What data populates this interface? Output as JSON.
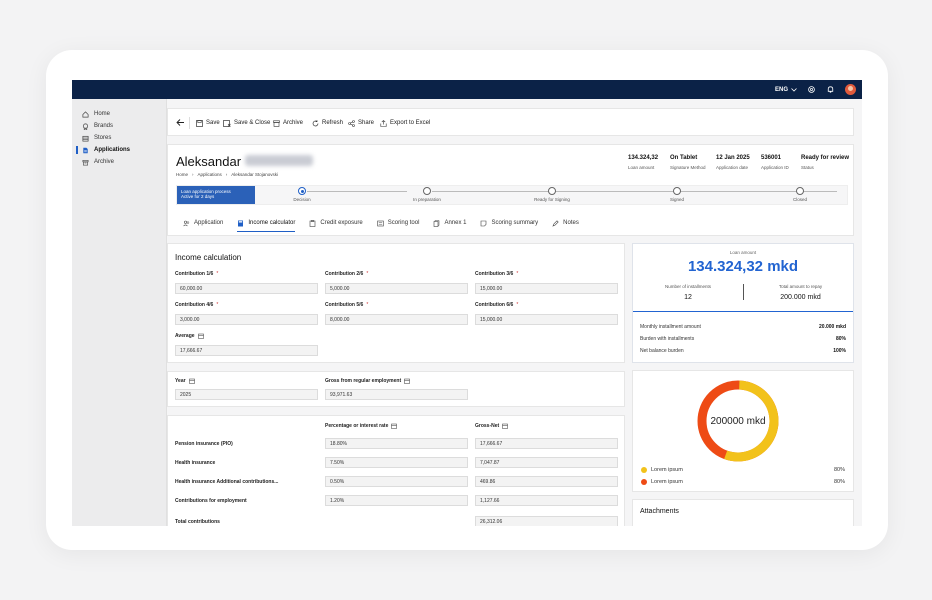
{
  "topbar": {
    "language": "ENG"
  },
  "sidebar": {
    "items": [
      {
        "label": "Home",
        "icon": "home-icon"
      },
      {
        "label": "Brands",
        "icon": "brand-icon"
      },
      {
        "label": "Stores",
        "icon": "store-icon"
      },
      {
        "label": "Applications",
        "icon": "document-icon",
        "active": true
      },
      {
        "label": "Archive",
        "icon": "archive-icon"
      }
    ]
  },
  "toolbar": {
    "save": "Save",
    "save_close": "Save & Close",
    "archive": "Archive",
    "refresh": "Refresh",
    "share": "Share",
    "export": "Export to Excel"
  },
  "header": {
    "name": "Aleksandar",
    "breadcrumb": [
      "Home",
      "Applications",
      "Aleksandar Stojanovski"
    ],
    "summary": [
      {
        "value": "134.324,32",
        "label": "Loan amount"
      },
      {
        "value": "On Tablet",
        "label": "Signature Method"
      },
      {
        "value": "12 Jan 2025",
        "label": "Application date"
      },
      {
        "value": "536001",
        "label": "Application ID"
      },
      {
        "value": "Ready for review",
        "label": "Status"
      }
    ],
    "process": {
      "title": "Loan application process",
      "subtitle": "Active for 2 days"
    },
    "steps": [
      "Decision",
      "In preparation",
      "Ready for Signing",
      "Signed",
      "Closed"
    ]
  },
  "tabs": [
    "Application",
    "Income calculator",
    "Credit exposure",
    "Scoring tool",
    "Annex 1",
    "Scoring summary",
    "Notes"
  ],
  "income": {
    "title": "Income calculation",
    "fields": [
      {
        "label": "Contribution 1/6",
        "value": "60,000.00"
      },
      {
        "label": "Contribution 2/6",
        "value": "5,000.00"
      },
      {
        "label": "Contribution 3/6",
        "value": "15,000.00"
      },
      {
        "label": "Contribution 4/6",
        "value": "3,000.00"
      },
      {
        "label": "Contribution 5/6",
        "value": "8,000.00"
      },
      {
        "label": "Contribution 6/6",
        "value": "15,000.00"
      }
    ],
    "average_label": "Average",
    "average_value": "17,666.67"
  },
  "year_panel": {
    "year_label": "Year",
    "year_value": "2025",
    "gross_label": "Gross from regular employment",
    "gross_value": "93,971.63"
  },
  "contrib_table": {
    "col1": "Percentage or interest rate",
    "col2": "Gross-Net",
    "rows": [
      {
        "label": "Pension insurance (PIO)",
        "rate": "18.80%",
        "amount": "17,666.67"
      },
      {
        "label": "Health insurance",
        "rate": "7.50%",
        "amount": "7,047.87"
      },
      {
        "label": "Health insurance Additional contributions...",
        "rate": "0.50%",
        "amount": "469.86"
      },
      {
        "label": "Contributions for employment",
        "rate": "1.20%",
        "amount": "1,127.66"
      },
      {
        "label": "Total contributions",
        "rate": "",
        "amount": "26,312.06"
      }
    ]
  },
  "loan_card": {
    "caption": "Loan amount",
    "amount": "134.324,32 mkd",
    "installments_label": "Number of installments",
    "installments": "12",
    "total_label": "Total amount to repay",
    "total": "200.000 mkd",
    "rows": [
      {
        "label": "Monthly installment amount",
        "value": "20.000 mkd"
      },
      {
        "label": "Burden with installments",
        "value": "80%"
      },
      {
        "label": "Net balance burden",
        "value": "100%"
      }
    ]
  },
  "donut": {
    "center": "200000 mkd",
    "legend": [
      {
        "label": "Lorem ipsum",
        "value": "80%",
        "color": "#f2c21b"
      },
      {
        "label": "Lorem ipsum",
        "value": "80%",
        "color": "#ee4b15"
      }
    ],
    "fill_fraction": 0.55
  },
  "attachments": {
    "title": "Attachments"
  },
  "colors": {
    "topbar": "#0b2247",
    "accent": "#1f5fc6",
    "amount": "#2264d1"
  }
}
